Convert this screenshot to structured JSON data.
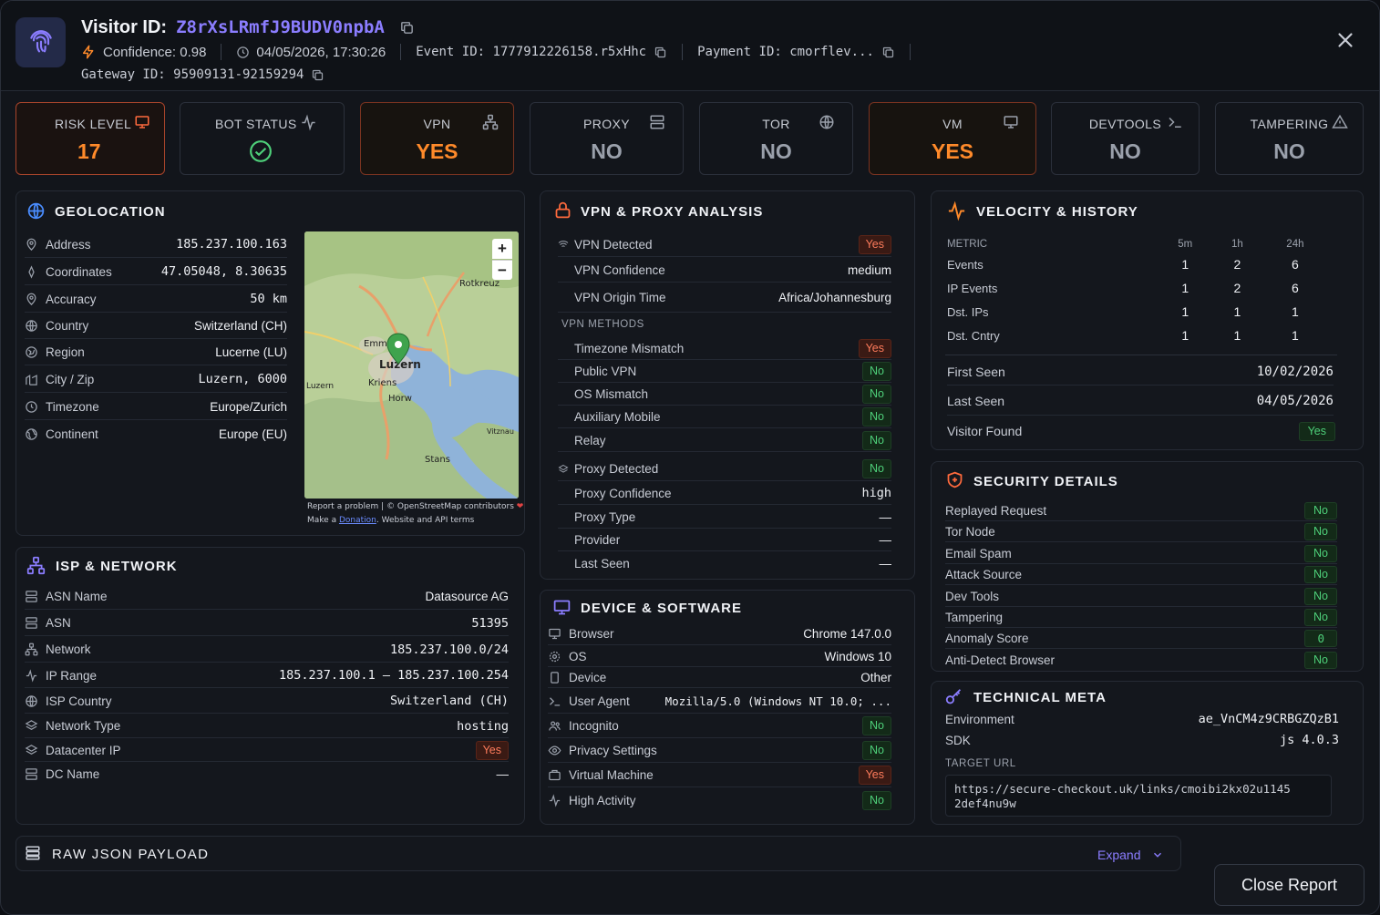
{
  "header": {
    "title_prefix": "Visitor ID:",
    "visitor_id": "Z8rXsLRmfJ9BUDV0npbA",
    "confidence": "Confidence: 0.98",
    "timestamp": "04/05/2026, 17:30:26",
    "event_id": "Event ID: 1777912226158.r5xHhc",
    "payment_id": "Payment ID: cmorflev...",
    "gateway_id": "Gateway ID: 95909131-92159294"
  },
  "tiles": [
    {
      "label": "RISK LEVEL",
      "value": "17",
      "icon": "monitor-icon"
    },
    {
      "label": "BOT STATUS",
      "value": "",
      "icon": "activity-icon"
    },
    {
      "label": "VPN",
      "value": "YES",
      "icon": "network-icon"
    },
    {
      "label": "PROXY",
      "value": "NO",
      "icon": "server-icon"
    },
    {
      "label": "TOR",
      "value": "NO",
      "icon": "globe-icon"
    },
    {
      "label": "VM",
      "value": "YES",
      "icon": "monitor-icon"
    },
    {
      "label": "DEVTOOLS",
      "value": "NO",
      "icon": "terminal-icon"
    },
    {
      "label": "TAMPERING",
      "value": "NO",
      "icon": "warning-icon"
    }
  ],
  "geo": {
    "title": "GEOLOCATION",
    "rows": [
      {
        "label": "Address",
        "value": "185.237.100.163"
      },
      {
        "label": "Coordinates",
        "value": "47.05048, 8.30635"
      },
      {
        "label": "Accuracy",
        "value": "50 km"
      },
      {
        "label": "Country",
        "value": "Switzerland (CH)"
      },
      {
        "label": "Region",
        "value": "Lucerne (LU)"
      },
      {
        "label": "City / Zip",
        "value": "Luzern, 6000"
      },
      {
        "label": "Timezone",
        "value": "Europe/Zurich"
      },
      {
        "label": "Continent",
        "value": "Europe (EU)"
      }
    ],
    "map_attr1": "Report a problem | © OpenStreetMap contributors",
    "map_attr2_pre": "Make a ",
    "map_attr2_link": "Donation",
    "map_attr2_post": ". Website and API terms",
    "map_labels": [
      "Rotkreuz",
      "Emmen",
      "Luzern",
      "Kriens",
      "Horw",
      "Luzern",
      "Stans",
      "Vitznau"
    ]
  },
  "isp": {
    "title": "ISP & NETWORK",
    "rows": [
      {
        "label": "ASN Name",
        "value": "Datasource AG"
      },
      {
        "label": "ASN",
        "value": "51395"
      },
      {
        "label": "Network",
        "value": "185.237.100.0/24"
      },
      {
        "label": "IP Range",
        "value": "185.237.100.1 – 185.237.100.254"
      },
      {
        "label": "ISP Country",
        "value": "Switzerland (CH)"
      },
      {
        "label": "Network Type",
        "value": "hosting"
      },
      {
        "label": "Datacenter IP",
        "value": "Yes"
      },
      {
        "label": "DC Name",
        "value": "—"
      }
    ]
  },
  "vpn": {
    "title": "VPN & PROXY ANALYSIS",
    "detected_label": "VPN Detected",
    "detected": "Yes",
    "conf_label": "VPN Confidence",
    "conf": "medium",
    "origin_label": "VPN Origin Time",
    "origin": "Africa/Johannesburg",
    "methods_title": "VPN METHODS",
    "methods": [
      {
        "label": "Timezone Mismatch",
        "value": "Yes"
      },
      {
        "label": "Public VPN",
        "value": "No"
      },
      {
        "label": "OS Mismatch",
        "value": "No"
      },
      {
        "label": "Auxiliary Mobile",
        "value": "No"
      },
      {
        "label": "Relay",
        "value": "No"
      }
    ],
    "proxy_label": "Proxy Detected",
    "proxy": "No",
    "pconf_label": "Proxy Confidence",
    "pconf": "high",
    "ptype_label": "Proxy Type",
    "ptype": "—",
    "provider_label": "Provider",
    "provider": "—",
    "lastseen_label": "Last Seen",
    "lastseen": "—"
  },
  "device": {
    "title": "DEVICE & SOFTWARE",
    "rows": [
      {
        "label": "Browser",
        "value": "Chrome 147.0.0"
      },
      {
        "label": "OS",
        "value": "Windows 10"
      },
      {
        "label": "Device",
        "value": "Other"
      },
      {
        "label": "User Agent",
        "value": "Mozilla/5.0 (Windows NT 10.0; ..."
      },
      {
        "label": "Incognito",
        "value": "No"
      },
      {
        "label": "Privacy Settings",
        "value": "No"
      },
      {
        "label": "Virtual Machine",
        "value": "Yes"
      },
      {
        "label": "High Activity",
        "value": "No"
      }
    ]
  },
  "velocity": {
    "title": "VELOCITY & HISTORY",
    "headers": [
      "METRIC",
      "5m",
      "1h",
      "24h"
    ],
    "rows": [
      [
        "Events",
        "1",
        "2",
        "6"
      ],
      [
        "IP Events",
        "1",
        "2",
        "6"
      ],
      [
        "Dst. IPs",
        "1",
        "1",
        "1"
      ],
      [
        "Dst. Cntry",
        "1",
        "1",
        "1"
      ]
    ],
    "first_seen_label": "First Seen",
    "first_seen": "10/02/2026",
    "last_seen_label": "Last Seen",
    "last_seen": "04/05/2026",
    "visitor_found_label": "Visitor Found",
    "visitor_found": "Yes"
  },
  "security": {
    "title": "SECURITY DETAILS",
    "rows": [
      {
        "label": "Replayed Request",
        "value": "No"
      },
      {
        "label": "Tor Node",
        "value": "No"
      },
      {
        "label": "Email Spam",
        "value": "No"
      },
      {
        "label": "Attack Source",
        "value": "No"
      },
      {
        "label": "Dev Tools",
        "value": "No"
      },
      {
        "label": "Tampering",
        "value": "No"
      },
      {
        "label": "Anomaly Score",
        "value": "0"
      },
      {
        "label": "Anti-Detect Browser",
        "value": "No"
      }
    ]
  },
  "tech": {
    "title": "TECHNICAL META",
    "env_label": "Environment",
    "env": "ae_VnCM4z9CRBGZQzB1",
    "sdk_label": "SDK",
    "sdk": "js 4.0.3",
    "url_label": "TARGET URL",
    "url_line1": "https://secure-checkout.uk/links/cmoibi2kx02u1145",
    "url_line2": "2def4nu9w"
  },
  "raw": {
    "title": "RAW JSON PAYLOAD",
    "expand": "Expand"
  },
  "close_button": "Close Report",
  "colors": {
    "accent": "#8b7dff",
    "orange": "#ff8a2a",
    "green": "#4ed07a",
    "red": "#ff7c5c"
  }
}
